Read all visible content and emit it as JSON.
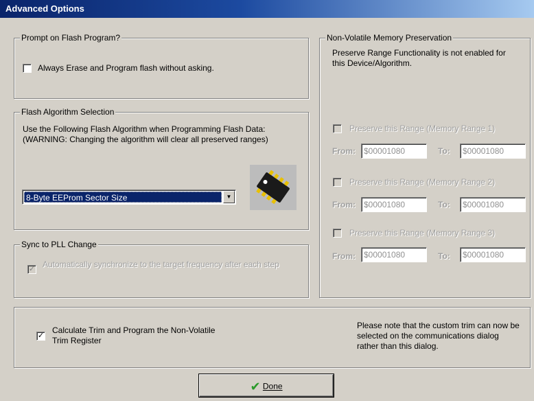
{
  "window": {
    "title": "Advanced Options"
  },
  "prompt_group": {
    "legend": "Prompt on Flash Program?",
    "checkbox_label": "Always Erase and Program flash without asking.",
    "checked": false
  },
  "flash_algorithm": {
    "legend": "Flash Algorithm Selection",
    "description": "Use the Following Flash Algorithm when Programming Flash Data: (WARNING: Changing the algorithm will clear all preserved ranges)",
    "selected": "8-Byte EEProm Sector Size",
    "chip_icon": "ic-chip-icon"
  },
  "sync_pll": {
    "legend": "Sync to PLL Change",
    "checkbox_label": "Automatically synchronize to the target frequency after each step",
    "checked": true,
    "enabled": false
  },
  "nvm": {
    "legend": "Non-Volatile Memory Preservation",
    "note": "Preserve Range Functionality is not enabled for this Device/Algorithm.",
    "from_label": "From:",
    "to_label": "To:",
    "ranges": [
      {
        "label": "Preserve this Range (Memory Range 1)",
        "from": "$00001080",
        "to": "$00001080",
        "checked": false
      },
      {
        "label": "Preserve this Range (Memory Range 2)",
        "from": "$00001080",
        "to": "$00001080",
        "checked": false
      },
      {
        "label": "Preserve this Range (Memory Range 3)",
        "from": "$00001080",
        "to": "$00001080",
        "checked": false
      }
    ]
  },
  "trim": {
    "checkbox_label": "Calculate Trim and Program the Non-Volatile Trim Register",
    "checked": true,
    "note": "Please note that the custom trim can now be selected on the communications dialog rather than this dialog."
  },
  "done_button": {
    "label": "Done",
    "icon": "green-checkmark-icon"
  }
}
